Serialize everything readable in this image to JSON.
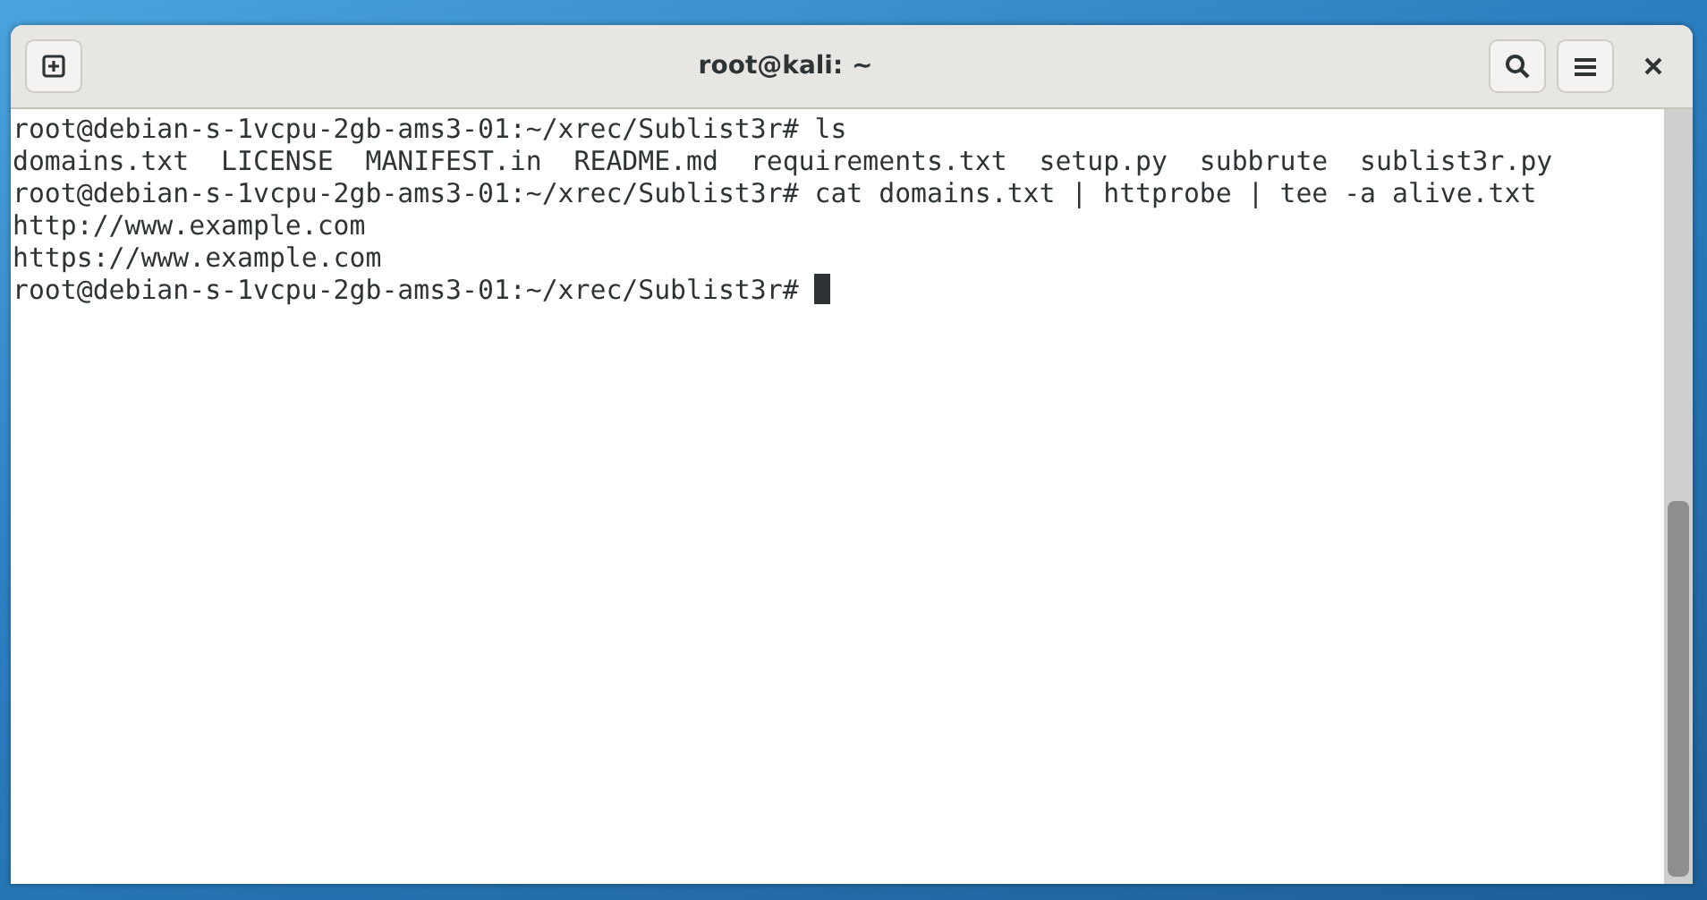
{
  "window": {
    "title": "root@kali: ~"
  },
  "terminal": {
    "lines": [
      {
        "text": "root@debian-s-1vcpu-2gb-ams3-01:~/xrec/Sublist3r# ls",
        "cursor": false
      },
      {
        "text": "domains.txt  LICENSE  MANIFEST.in  README.md  requirements.txt  setup.py  subbrute  sublist3r.py",
        "cursor": false
      },
      {
        "text": "root@debian-s-1vcpu-2gb-ams3-01:~/xrec/Sublist3r# cat domains.txt | httprobe | tee -a alive.txt",
        "cursor": false
      },
      {
        "text": "http://www.example.com",
        "cursor": false
      },
      {
        "text": "https://www.example.com",
        "cursor": false
      },
      {
        "text": "root@debian-s-1vcpu-2gb-ams3-01:~/xrec/Sublist3r# ",
        "cursor": true
      }
    ]
  }
}
